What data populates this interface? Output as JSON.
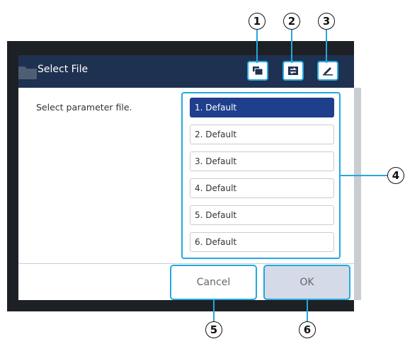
{
  "dialog": {
    "title": "Select File",
    "prompt": "Select parameter file."
  },
  "toolbar": [
    {
      "icon": "folder-copy-icon"
    },
    {
      "icon": "swap-file-icon"
    },
    {
      "icon": "edit-pen-icon"
    }
  ],
  "files": {
    "selected_index": 0,
    "items": [
      "1. Default",
      "2. Default",
      "3. Default",
      "4. Default",
      "5. Default",
      "6. Default"
    ]
  },
  "actions": {
    "cancel_label": "Cancel",
    "ok_label": "OK"
  },
  "callouts": [
    "1",
    "2",
    "3",
    "4",
    "5",
    "6"
  ],
  "colors": {
    "titlebar": "#1f3150",
    "highlight": "#24a8df",
    "selected": "#1f3e8c",
    "ok_button": "#d4dae8"
  }
}
